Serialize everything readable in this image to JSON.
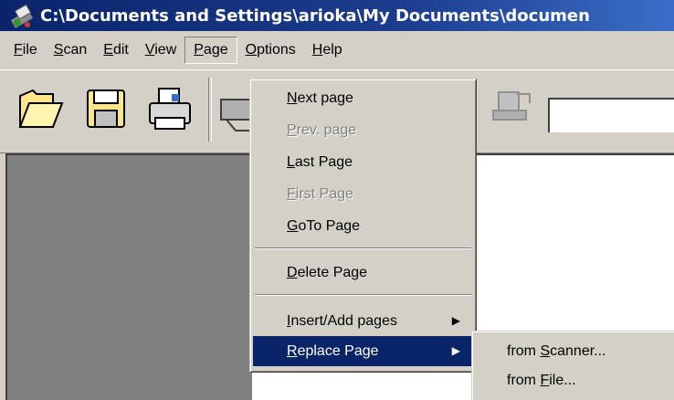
{
  "window": {
    "title": "C:\\Documents and Settings\\arioka\\My Documents\\documen"
  },
  "menubar": {
    "items": [
      {
        "key": "F",
        "rest": "ile"
      },
      {
        "key": "S",
        "rest": "can"
      },
      {
        "key": "E",
        "rest": "dit"
      },
      {
        "key": "V",
        "rest": "iew"
      },
      {
        "key": "P",
        "rest": "age"
      },
      {
        "key": "O",
        "rest": "ptions"
      },
      {
        "key": "H",
        "rest": "elp"
      }
    ]
  },
  "toolbar": {
    "icons": [
      "open-folder-icon",
      "save-disk-icon",
      "print-icon",
      "scanner-icon",
      "page-nav-icon"
    ]
  },
  "page_menu": {
    "items": [
      {
        "pre": "",
        "key": "N",
        "post": "ext page",
        "disabled": false
      },
      {
        "pre": "",
        "key": "P",
        "post": "rev. page",
        "disabled": true
      },
      {
        "pre": "",
        "key": "L",
        "post": "ast Page",
        "disabled": false
      },
      {
        "pre": "",
        "key": "F",
        "post": "irst Page",
        "disabled": true
      },
      {
        "pre": "",
        "key": "G",
        "post": "oTo Page",
        "disabled": false
      },
      {
        "pre": "",
        "key": "D",
        "post": "elete Page",
        "disabled": false
      },
      {
        "pre": "",
        "key": "I",
        "post": "nsert/Add pages",
        "disabled": false,
        "submenu": true
      },
      {
        "pre": "",
        "key": "R",
        "post": "eplace Page",
        "disabled": false,
        "submenu": true,
        "highlighted": true
      }
    ]
  },
  "replace_submenu": {
    "items": [
      {
        "pre": "from ",
        "key": "S",
        "post": "canner..."
      },
      {
        "pre": "from ",
        "key": "F",
        "post": "ile..."
      }
    ]
  },
  "colors": {
    "titlebar": "#0a246a",
    "highlight": "#0a246a",
    "face": "#d4d0c8",
    "workspace": "#808080"
  }
}
